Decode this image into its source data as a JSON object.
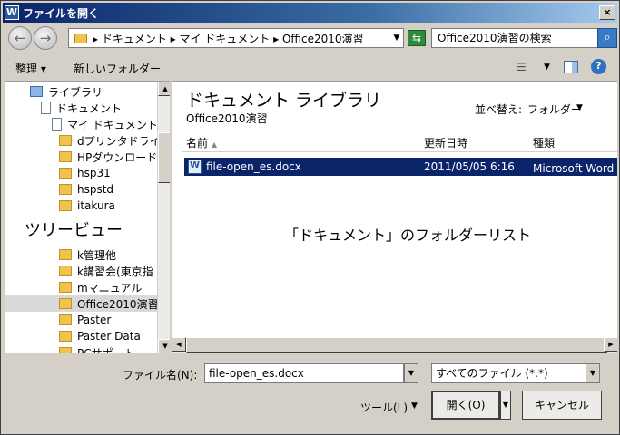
{
  "window": {
    "title": "ファイルを開く",
    "app_icon": "W",
    "close": "×"
  },
  "address": {
    "path": "▸ ドキュメント ▸ マイ ドキュメント ▸ Office2010演習",
    "search_placeholder": "Office2010演習の検索"
  },
  "toolbar": {
    "organize_label": "整理 ▾",
    "new_folder_label": "新しいフォルダー"
  },
  "tree": {
    "items": [
      {
        "label": "ライブラリ",
        "icon": "library-icon"
      },
      {
        "label": "ドキュメント",
        "icon": "document-icon"
      },
      {
        "label": "マイ ドキュメント",
        "icon": "document-icon"
      },
      {
        "label": "dプリンタドライバ",
        "icon": "folder-icon"
      },
      {
        "label": "HPダウンロード",
        "icon": "folder-icon"
      },
      {
        "label": "hsp31",
        "icon": "folder-icon"
      },
      {
        "label": "hspstd",
        "icon": "folder-icon"
      },
      {
        "label": "itakura",
        "icon": "folder-icon"
      },
      {
        "label": "k管理他",
        "icon": "folder-icon"
      },
      {
        "label": "k講習会(東京指",
        "icon": "folder-icon"
      },
      {
        "label": "mマニュアル",
        "icon": "folder-icon"
      },
      {
        "label": "Office2010演習",
        "icon": "folder-icon",
        "selected": true
      },
      {
        "label": "Paster",
        "icon": "folder-icon"
      },
      {
        "label": "Paster Data",
        "icon": "folder-icon"
      },
      {
        "label": "PCサポート",
        "icon": "folder-icon"
      }
    ],
    "caption": "ツリービュー"
  },
  "library": {
    "title": "ドキュメント ライブラリ",
    "subtitle": "Office2010演習",
    "arrange_label": "並べ替え:",
    "arrange_value": "フォルダー"
  },
  "columns": {
    "name": "名前",
    "date": "更新日時",
    "type": "種類"
  },
  "files": [
    {
      "name": "file-open_es.docx",
      "date": "2011/05/05 6:16",
      "type": "Microsoft Word 文"
    }
  ],
  "file_caption": "「ドキュメント」のフォルダーリスト",
  "bottom": {
    "filename_label": "ファイル名(N):",
    "filename_value": "file-open_es.docx",
    "filetype_value": "すべてのファイル (*.*)",
    "tools_label": "ツール(L)",
    "open_label": "開く(O)",
    "cancel_label": "キャンセル"
  }
}
